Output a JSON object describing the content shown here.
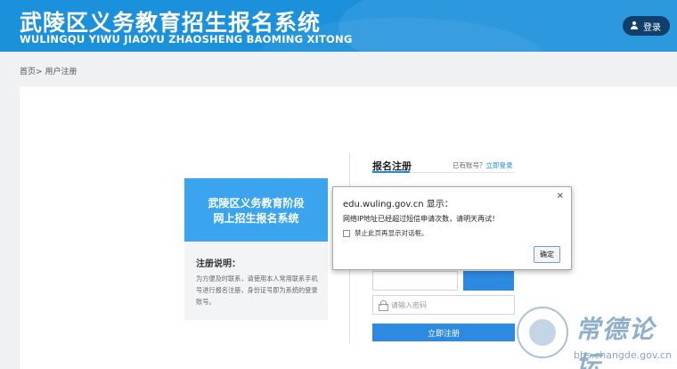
{
  "header": {
    "title": "武陵区义务教育招生报名系统",
    "subtitle": "WULINGQU YIWU JIAOYU ZHAOSHENG BAOMING XITONG",
    "login_label": "登录"
  },
  "breadcrumb": {
    "home": "首页>",
    "current": "用户注册"
  },
  "info_card": {
    "banner_line1": "武陵区义务教育阶段",
    "banner_line2": "网上招生报名系统",
    "note_title": "注册说明：",
    "note_body": "为方便及时联系，请使用本人常用联系手机号进行报名注册，身份证号即为系统的登录账号。"
  },
  "form": {
    "title": "报名注册",
    "have_account": "已有账号？",
    "login_link": "立即登录",
    "password_placeholder": "请输入密码",
    "submit_label": "立即注册"
  },
  "dialog": {
    "title": "edu.wuling.gov.cn 显示：",
    "message": "网络IP地址已经超过短信申请次数，请明天再试！",
    "checkbox_label": "禁止此页再显示对话框。",
    "ok_label": "确定"
  },
  "watermark": {
    "text": "常德论坛",
    "url": "bbs.changde.gov.cn"
  },
  "colors": {
    "header_bg": "#1b90db",
    "accent": "#2d8ae0",
    "banner_bg": "#3aa4ee"
  }
}
